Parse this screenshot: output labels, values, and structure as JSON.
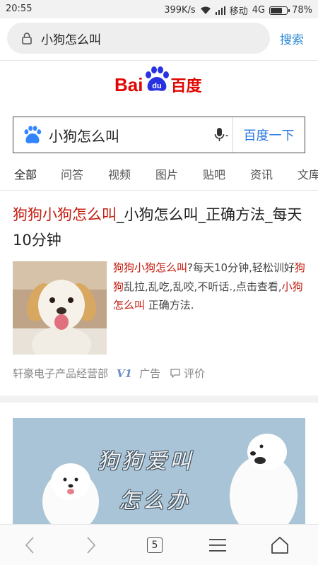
{
  "status_bar": {
    "time": "20:55",
    "net_speed": "399K/s",
    "carrier": "移动",
    "network": "4G",
    "battery": "78%",
    "battery_level": 0.78
  },
  "browser": {
    "address_query": "小狗怎么叫",
    "search_label": "搜索",
    "tab_count": "5"
  },
  "logo": {
    "latin_a": "Bai",
    "du": "du",
    "cn": "百度"
  },
  "search": {
    "query": "小狗怎么叫",
    "button_label": "百度一下"
  },
  "tabs": [
    "全部",
    "问答",
    "视频",
    "图片",
    "贴吧",
    "资讯",
    "文库"
  ],
  "active_tab": "全部",
  "result1": {
    "title_hl": "狗狗小狗怎么叫",
    "title_rest": "_小狗怎么叫_正确方法_每天10分钟",
    "desc_hl1": "狗狗小狗怎么叫",
    "desc_t1": "?每天10分钟,轻松训好",
    "desc_hl2": "狗狗",
    "desc_t2": "乱拉,乱吃,乱咬,不听话.,点击查看,",
    "desc_hl3": "小狗怎么叫",
    "desc_t3": " 正确方法.",
    "source": "轩豪电子产品经营部",
    "v_badge": "V1",
    "ad_label": "广告",
    "review_label": "评价"
  },
  "result2": {
    "banner_line1": "狗狗爱叫",
    "banner_line2": "怎么办"
  },
  "colors": {
    "highlight": "#c31c0f",
    "link_blue": "#2b8ad6",
    "baidu_red": "#e10601",
    "baidu_blue": "#2932e1"
  }
}
